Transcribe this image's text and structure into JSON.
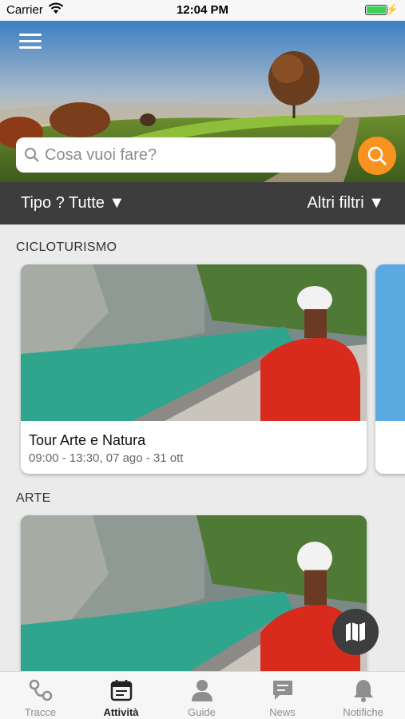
{
  "status_bar": {
    "carrier": "Carrier",
    "time": "12:04 PM",
    "battery_color": "#3ad15b"
  },
  "header": {
    "menu_icon": "hamburger-menu-icon",
    "search_placeholder": "Cosa vuoi fare?",
    "search_button_icon": "search-icon",
    "accent_color": "#f7931e"
  },
  "filters": {
    "type_label": "Tipo ? Tutte ▼",
    "more_label": "Altri filtri ▼"
  },
  "sections": [
    {
      "title": "CICLOTURISMO",
      "cards": [
        {
          "title": "Tour Arte e Natura",
          "date": "09:00 - 13:30, 07 ago - 31 ott"
        }
      ]
    },
    {
      "title": "ARTE",
      "cards": [
        {
          "title": "",
          "date": ""
        }
      ]
    }
  ],
  "map_button_icon": "map-icon",
  "tabs": [
    {
      "label": "Tracce",
      "icon": "route-icon",
      "active": false
    },
    {
      "label": "Attività",
      "icon": "calendar-icon",
      "active": true
    },
    {
      "label": "Guide",
      "icon": "person-icon",
      "active": false
    },
    {
      "label": "News",
      "icon": "chat-bubble-icon",
      "active": false
    },
    {
      "label": "Notifiche",
      "icon": "bell-icon",
      "active": false
    }
  ]
}
